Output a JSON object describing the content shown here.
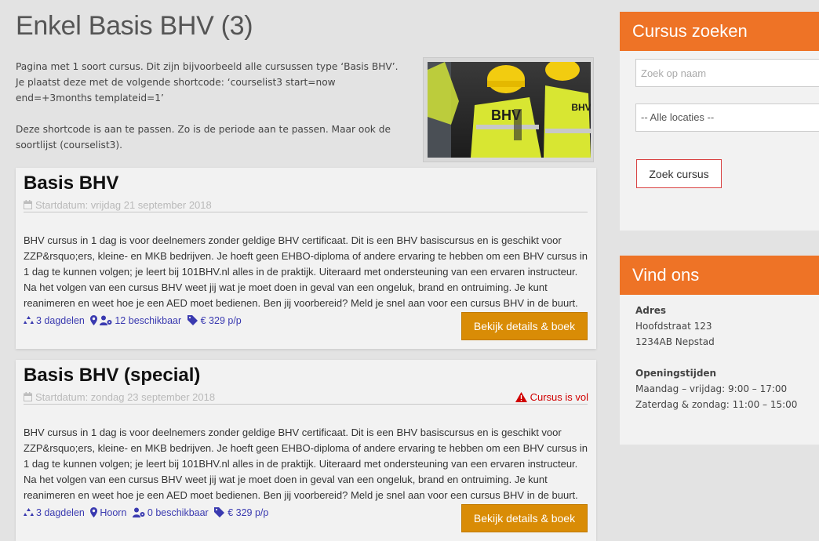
{
  "page": {
    "title": "Enkel Basis BHV (3)",
    "intro_lines": [
      "Pagina met 1 soort cursus. Dit zijn bijvoorbeeld alle cursussen type ‘Basis BHV’.",
      "Je plaatst deze met de volgende shortcode: ‘courselist3 start=now end=+3months templateid=1’",
      "Deze shortcode is aan te passen. Zo is de periode aan te passen. Maar ook de soortlijst (courselist3)."
    ],
    "hero_image": {
      "vest_text": "BHV",
      "vest_text_right": "BHV"
    }
  },
  "courses": [
    {
      "title": "Basis BHV",
      "date": "Startdatum: vrijdag 21 september 2018",
      "status": "",
      "description": "BHV cursus in 1 dag is voor deelnemers zonder geldige BHV certificaat. Dit is een BHV basiscursus en is geschikt voor ZZP&rsquo;ers, kleine- en MKB bedrijven. Je hoeft geen EHBO-diploma of andere ervaring te hebben om een BHV cursus in 1 dag te kunnen volgen; je leert bij 101BHV.nl alles in de praktijk. Uiteraard met ondersteuning van een ervaren instructeur. Na het volgen van een cursus BHV weet jij wat je moet doen in geval van een ongeluk, brand en ontruiming. Je kunt reanimeren en weet hoe je een AED moet bedienen. Ben jij voorbereid? Meld je snel aan voor een cursus BHV in de buurt.",
      "parts": "3 dagdelen",
      "location": "",
      "availability": "12 beschikbaar",
      "price": "€ 329 p/p",
      "book_label": "Bekijk details & boek"
    },
    {
      "title": "Basis BHV (special)",
      "date": "Startdatum: zondag 23 september 2018",
      "status": "Cursus is vol",
      "description": "BHV cursus in 1 dag is voor deelnemers zonder geldige BHV certificaat. Dit is een BHV basiscursus en is geschikt voor ZZP&rsquo;ers, kleine- en MKB bedrijven. Je hoeft geen EHBO-diploma of andere ervaring te hebben om een BHV cursus in 1 dag te kunnen volgen; je leert bij 101BHV.nl alles in de praktijk. Uiteraard met ondersteuning van een ervaren instructeur. Na het volgen van een cursus BHV weet jij wat je moet doen in geval van een ongeluk, brand en ontruiming. Je kunt reanimeren en weet hoe je een AED moet bedienen. Ben jij voorbereid? Meld je snel aan voor een cursus BHV in de buurt.",
      "parts": "3 dagdelen",
      "location": "Hoorn",
      "availability": "0 beschikbaar",
      "price": "€ 329 p/p",
      "book_label": "Bekijk details & boek"
    }
  ],
  "sidebar": {
    "search": {
      "heading": "Cursus zoeken",
      "name_placeholder": "Zoek op naam",
      "location_selected": "-- Alle locaties --",
      "button_label": "Zoek cursus"
    },
    "find_us": {
      "heading": "Vind ons",
      "address_label": "Adres",
      "street": "Hoofdstraat 123",
      "postal_city": "1234AB Nepstad",
      "hours_label": "Openingstijden",
      "hours_weekdays": "Maandag – vrijdag: 9:00 – 17:00",
      "hours_weekend": "Zaterdag & zondag: 11:00 – 15:00"
    }
  },
  "colors": {
    "accent_orange": "#ee7326",
    "button_orange": "#d98c06",
    "link_blue": "#3a3ab0",
    "alert_red": "#d00000"
  }
}
